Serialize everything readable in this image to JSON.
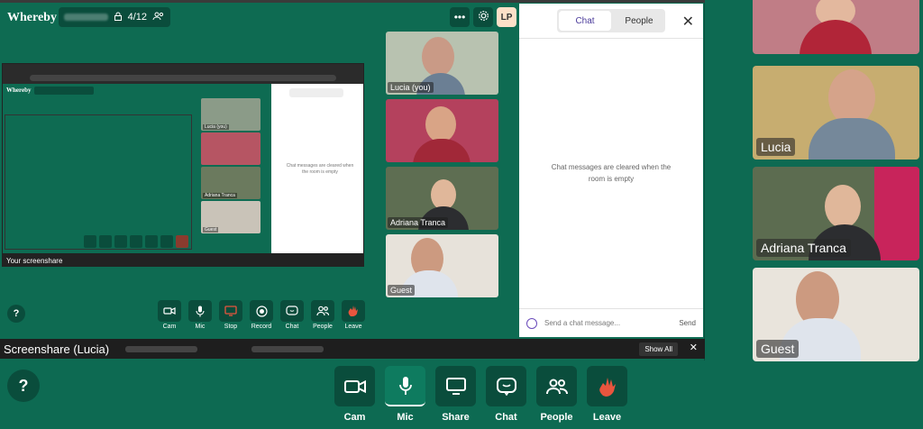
{
  "app": {
    "brand": "Whereby",
    "room_count": "4/12",
    "avatar_initials": "LP"
  },
  "header": {
    "more_icon": "more-icon",
    "settings_icon": "gear-icon"
  },
  "chat": {
    "tabs": [
      "Chat",
      "People"
    ],
    "empty_message": "Chat messages are cleared when the room is empty",
    "input_placeholder": "Send a chat message...",
    "send_label": "Send"
  },
  "tiles": [
    {
      "label": "Lucia (you)"
    },
    {
      "label": ""
    },
    {
      "label": "Adriana Tranca"
    },
    {
      "label": "Guest"
    }
  ],
  "right_tiles": [
    {
      "label": ""
    },
    {
      "label": "Lucia"
    },
    {
      "label": "Adriana Tranca"
    },
    {
      "label": "Guest"
    }
  ],
  "inner_toolbar": [
    {
      "label": "Cam",
      "icon": "camera-icon"
    },
    {
      "label": "Mic",
      "icon": "mic-icon"
    },
    {
      "label": "Stop",
      "icon": "stop-share-icon"
    },
    {
      "label": "Record",
      "icon": "record-icon"
    },
    {
      "label": "Chat",
      "icon": "chat-icon"
    },
    {
      "label": "People",
      "icon": "people-icon"
    },
    {
      "label": "Leave",
      "icon": "leave-icon"
    }
  ],
  "share_bar": {
    "label": "Screenshare (Lucia)",
    "show_all": "Show All"
  },
  "main_toolbar": [
    {
      "label": "Cam",
      "icon": "camera-icon"
    },
    {
      "label": "Mic",
      "icon": "mic-icon"
    },
    {
      "label": "Share",
      "icon": "share-screen-icon"
    },
    {
      "label": "Chat",
      "icon": "chat-icon"
    },
    {
      "label": "People",
      "icon": "people-icon"
    },
    {
      "label": "Leave",
      "icon": "leave-icon"
    }
  ],
  "nested": {
    "brand": "Whereby",
    "footer_label": "Your screenshare",
    "chat_empty": "Chat messages are cleared when the room is empty"
  },
  "colors": {
    "background": "#0d6a52",
    "toolbar_button": "#0a4d3c",
    "leave_icon": "#e8553e",
    "chat_tab_active": "#4b3b9b"
  }
}
